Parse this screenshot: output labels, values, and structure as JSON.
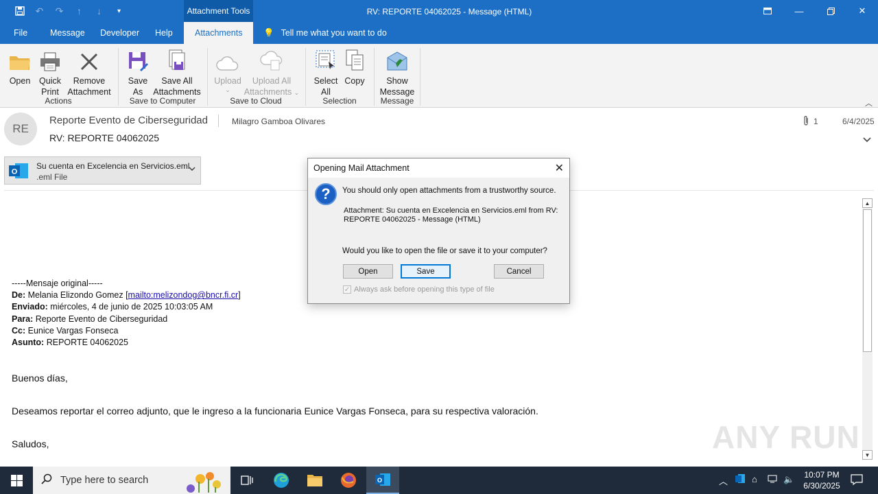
{
  "window": {
    "title": "RV: REPORTE 04062025  -  Message (HTML)",
    "context_tab": "Attachment Tools"
  },
  "menu": {
    "tabs": [
      "File",
      "Message",
      "Developer",
      "Help",
      "Attachments"
    ],
    "active_tab": "Attachments",
    "tell_me": "Tell me what you want to do"
  },
  "ribbon": {
    "open": "Open",
    "quick_print": [
      "Quick",
      "Print"
    ],
    "remove_attachment": [
      "Remove",
      "Attachment"
    ],
    "group_actions": "Actions",
    "save_as": [
      "Save",
      "As"
    ],
    "save_all": [
      "Save All",
      "Attachments"
    ],
    "group_save_computer": "Save to Computer",
    "upload": "Upload",
    "upload_all": [
      "Upload All",
      "Attachments"
    ],
    "group_save_cloud": "Save to Cloud",
    "select_all": [
      "Select",
      "All"
    ],
    "copy": "Copy",
    "group_selection": "Selection",
    "show_message": [
      "Show",
      "Message"
    ],
    "group_message": "Message"
  },
  "header": {
    "avatar_initials": "RE",
    "from": "Reporte Evento de Ciberseguridad",
    "to": "Milagro Gamboa Olivares",
    "subject": "RV: REPORTE 04062025",
    "attachment_count": "1",
    "date": "6/4/2025"
  },
  "attachment": {
    "name": "Su cuenta en Excelencia en Servicios.eml",
    "type": ".eml File"
  },
  "body": {
    "original_marker": "-----Mensaje original-----",
    "de_label": "De:",
    "de_value": "Melania Elizondo Gomez [",
    "de_link": "mailto:melizondog@bncr.fi.cr",
    "de_close": "]",
    "enviado_label": "Enviado:",
    "enviado_value": "miércoles, 4 de junio de 2025 10:03:05 AM",
    "para_label": "Para:",
    "para_value": "Reporte Evento de Ciberseguridad",
    "cc_label": "Cc:",
    "cc_value": "Eunice Vargas Fonseca",
    "asunto_label": "Asunto:",
    "asunto_value": "REPORTE 04062025",
    "greeting": "Buenos días,",
    "message": "Deseamos reportar el correo adjunto, que le ingreso a la funcionaria Eunice Vargas Fonseca, para su respectiva valoración.",
    "closing": "Saludos,"
  },
  "dialog": {
    "title": "Opening Mail Attachment",
    "warning": "You should only open attachments from a trustworthy source.",
    "detail": "Attachment: Su cuenta en Excelencia en Servicios.eml from RV: REPORTE 04062025 - Message (HTML)",
    "question": "Would you like to open the file or save it to your computer?",
    "open_label": "Open",
    "save_label": "Save",
    "cancel_label": "Cancel",
    "checkbox_label": "Always ask before opening this type of file",
    "checkbox_checked": true
  },
  "watermark": "ANY RUN",
  "taskbar": {
    "search_placeholder": "Type here to search",
    "time": "10:07 PM",
    "date": "6/30/2025"
  }
}
